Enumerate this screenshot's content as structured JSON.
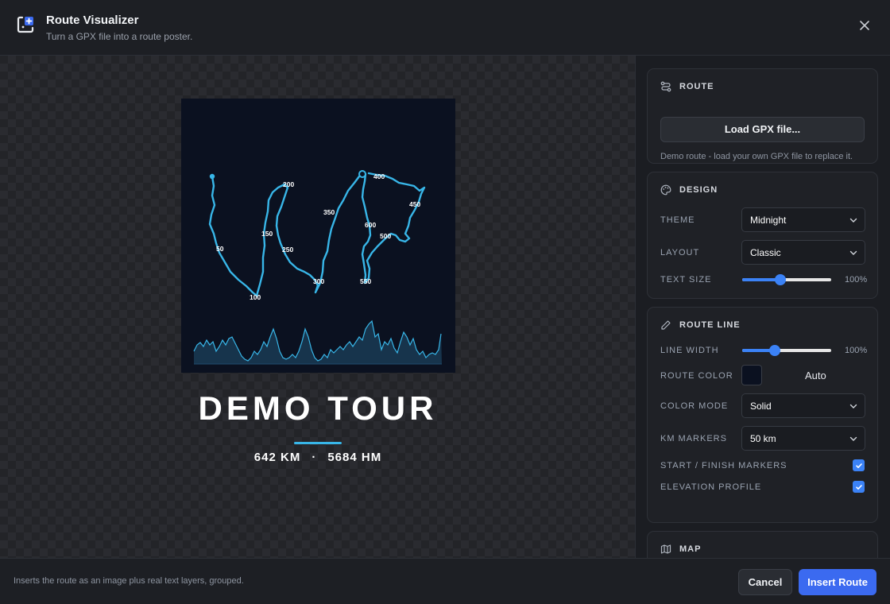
{
  "header": {
    "title": "Route Visualizer",
    "subtitle": "Turn a GPX file into a route poster.",
    "icon": "route-logo-icon",
    "close_icon": "close-icon"
  },
  "poster": {
    "title": "DEMO TOUR",
    "distance": "642 KM",
    "separator": "·",
    "elevation": "5684 HM",
    "colors": {
      "background": "#0b1120",
      "route": "#38b6e8",
      "accent": "#38b6e8"
    },
    "km_markers": [
      "50",
      "100",
      "150",
      "200",
      "250",
      "300",
      "350",
      "400",
      "450",
      "500",
      "550",
      "600"
    ]
  },
  "panel": {
    "route": {
      "title": "ROUTE",
      "load_button": "Load GPX file...",
      "hint": "Demo route - load your own GPX file to replace it."
    },
    "design": {
      "title": "DESIGN",
      "theme_label": "THEME",
      "theme_value": "Midnight",
      "layout_label": "LAYOUT",
      "layout_value": "Classic",
      "text_size_label": "TEXT SIZE",
      "text_size_value": "100%",
      "text_size_level": 0.42
    },
    "route_line": {
      "title": "ROUTE LINE",
      "line_width_label": "LINE WIDTH",
      "line_width_value": "100%",
      "line_width_level": 0.35,
      "route_color_label": "ROUTE COLOR",
      "route_color_value": "Auto",
      "color_mode_label": "COLOR MODE",
      "color_mode_value": "Solid",
      "km_markers_label": "KM MARKERS",
      "km_markers_value": "50 km",
      "start_finish_label": "START / FINISH MARKERS",
      "start_finish_checked": true,
      "elevation_label": "ELEVATION PROFILE",
      "elevation_checked": true
    },
    "map": {
      "title": "MAP"
    }
  },
  "footer": {
    "note": "Inserts the route as an image plus real text layers, grouped.",
    "cancel": "Cancel",
    "insert": "Insert Route"
  },
  "accent_color": "#3b6af0"
}
